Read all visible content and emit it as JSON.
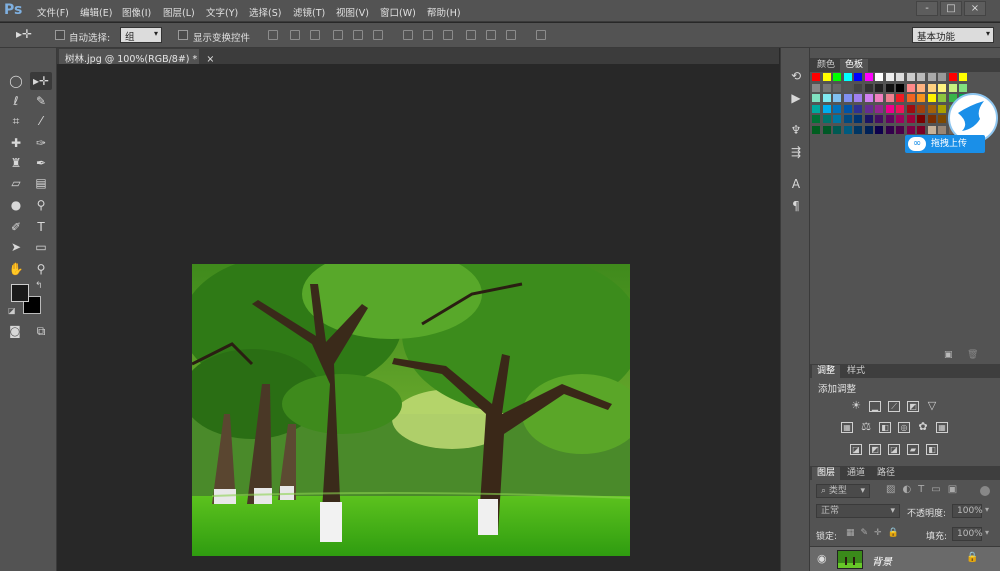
{
  "app": {
    "logo": "Ps"
  },
  "menubar": {
    "items": [
      "文件(F)",
      "编辑(E)",
      "图像(I)",
      "图层(L)",
      "文字(Y)",
      "选择(S)",
      "滤镜(T)",
      "视图(V)",
      "窗口(W)",
      "帮助(H)"
    ],
    "window_buttons": [
      "-",
      "□",
      "×"
    ]
  },
  "options": {
    "auto_select_label": "自动选择:",
    "auto_select_value": "组",
    "show_transform_label": "显示变换控件",
    "workspace": "基本功能"
  },
  "document": {
    "tab_title": "树林.jpg @ 100%(RGB/8#) *",
    "tab_close": "×"
  },
  "swatches_panel": {
    "tabs": [
      "颜色",
      "色板"
    ]
  },
  "upload_widget": {
    "label": "拖拽上传",
    "icon": "cloud-bird-icon"
  },
  "adjustments_panel": {
    "tabs": [
      "调整",
      "样式"
    ],
    "title": "添加调整"
  },
  "layers_panel": {
    "tabs": [
      "图层",
      "通道",
      "路径"
    ],
    "filter_kind": "类型",
    "blend_mode": "正常",
    "opacity_label": "不透明度:",
    "opacity_value": "100%",
    "lock_label": "锁定:",
    "fill_label": "填充:",
    "fill_value": "100%",
    "layer_name": "背景"
  },
  "colors": {
    "accent": "#1a8fe8",
    "bg": "#535353",
    "canvas": "#282828"
  }
}
